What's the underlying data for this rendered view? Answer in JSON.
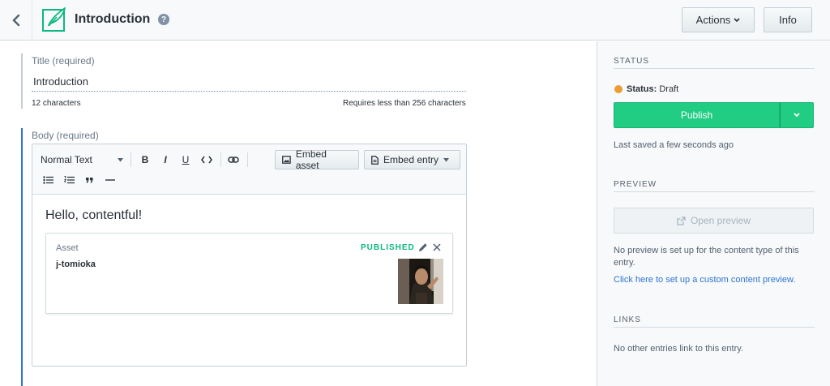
{
  "header": {
    "title": "Introduction",
    "help_glyph": "?",
    "actions_label": "Actions",
    "info_label": "Info"
  },
  "title_field": {
    "label": "Title (required)",
    "value": "Introduction",
    "char_count": "12 characters",
    "limit_hint": "Requires less than 256 characters"
  },
  "body_field": {
    "label": "Body (required)",
    "toolbar": {
      "format_select": "Normal Text",
      "bold": "B",
      "italic": "I",
      "underline": "U",
      "embed_asset_label": "Embed asset",
      "embed_entry_label": "Embed entry"
    },
    "heading": "Hello, contentful!",
    "asset": {
      "type_label": "Asset",
      "name": "j-tomioka",
      "status": "PUBLISHED"
    }
  },
  "sidebar": {
    "status": {
      "section_title": "STATUS",
      "status_label": "Status:",
      "status_value": "Draft",
      "status_color": "#ec9c32",
      "publish_label": "Publish",
      "last_saved": "Last saved a few seconds ago"
    },
    "preview": {
      "section_title": "PREVIEW",
      "open_preview_label": "Open preview",
      "note_line1": "No preview is set up for the content type of this",
      "note_line2": "entry.",
      "setup_link": "Click here to set up a custom content preview."
    },
    "links": {
      "section_title": "LINKS",
      "note": "No other entries link to this entry."
    }
  },
  "colors": {
    "accent": "#2e75d4",
    "publish_green": "#21cc83",
    "published_text": "#0eb87f"
  }
}
